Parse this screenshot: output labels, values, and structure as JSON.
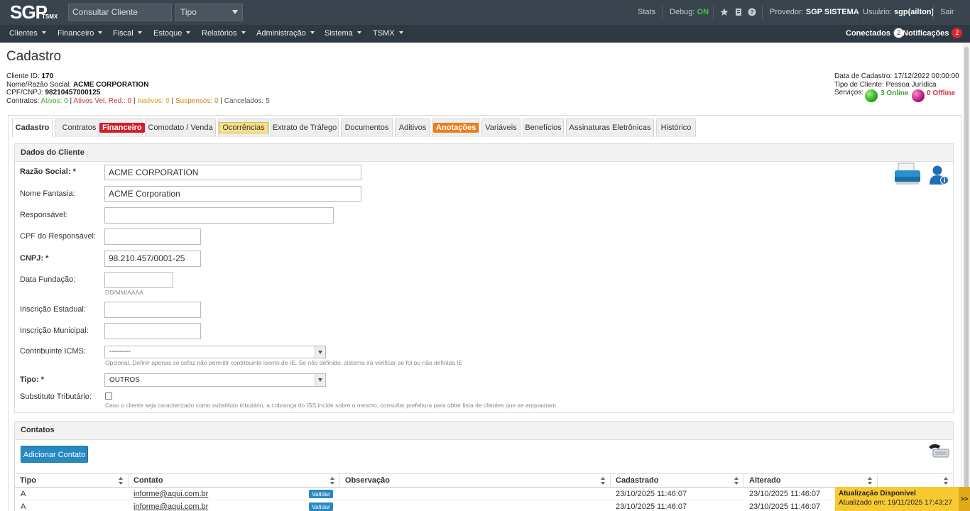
{
  "topbar": {
    "logo_text": "SGP",
    "logo_sub": "TSMX",
    "search_placeholder": "Consultar Cliente",
    "type_select": "Tipo",
    "stats": "Stats",
    "debug_label": "Debug:",
    "debug_value": "ON",
    "provider_label": "Provedor:",
    "provider_value": "SGP SISTEMA",
    "user_label": "Usuário:",
    "user_value": "sgp(ailton)",
    "logout": "Sair"
  },
  "nav": {
    "items": [
      "Clientes",
      "Financeiro",
      "Fiscal",
      "Estoque",
      "Relatórios",
      "Administração",
      "Sistema",
      "TSMX"
    ],
    "connected_label": "Conectados",
    "connected_count": "2",
    "notifications_label": "Notificações",
    "notifications_count": "2"
  },
  "page": {
    "title": "Cadastro",
    "client_id_label": "Cliente ID:",
    "client_id": "170",
    "name_label": "Nome/Razão Social:",
    "name": "ACME CORPORATION",
    "doc_label": "CPF/CNPJ:",
    "doc": "98210457000125",
    "contracts_label": "Contratos:",
    "active": "Ativos: 0",
    "active_red": "Ativos Vel. Red.: 0",
    "inactive": "Inativos: 0",
    "suspended": "Suspensos: 0",
    "cancelled": "Cancelados: 5",
    "reg_date_label": "Data de Cadastro:",
    "reg_date": "17/12/2022 00:00:00",
    "client_type_label": "Tipo de Cliente:",
    "client_type": "Pessoa Jurídica",
    "services_label": "Serviços:",
    "online": "3 Online",
    "offline": "0 Offline"
  },
  "tabs": [
    "Cadastro",
    "Contratos",
    "Financeiro",
    "Comodato / Venda",
    "Ocorrências",
    "Extrato de Tráfego",
    "Documentos",
    "Aditivos",
    "Anotações",
    "Variáveis",
    "Benefícios",
    "Assinaturas Eletrônicas",
    "Histórico"
  ],
  "form": {
    "section_title": "Dados do Cliente",
    "razao_label": "Razão Social:",
    "razao_value": "ACME CORPORATION",
    "fantasia_label": "Nome Fantasia:",
    "fantasia_value": "ACME Corporation",
    "responsavel_label": "Responsável:",
    "responsavel_value": "",
    "cpf_resp_label": "CPF do Responsável:",
    "cpf_resp_value": "",
    "cnpj_label": "CNPJ:",
    "cnpj_value": "98.210.457/0001-25",
    "fundacao_label": "Data Fundação:",
    "fundacao_value": "",
    "fundacao_help": "DD/MM/AAAA",
    "ie_label": "Inscrição Estadual:",
    "ie_value": "",
    "im_label": "Inscrição Municipal:",
    "im_value": "",
    "icms_label": "Contribuinte ICMS:",
    "icms_value": "---------",
    "icms_help": "Opcional. Definir apenas se sefaz não permitir contribuinte isento de IE. Se não definido, sistema irá verificar se foi ou não definida IE",
    "tipo_label": "Tipo:",
    "tipo_value": "OUTROS",
    "subst_label": "Substituto Tributário:",
    "subst_help": "Caso o cliente seja caracterizado como substituto tributário, a cobrança do ISS incide sobre o mesmo, consultar prefeitura para obter lista de clientes que se enquadram",
    "required_mark": "*"
  },
  "contacts": {
    "section_title": "Contatos",
    "add_button": "Adicionar Contato",
    "columns": [
      "Tipo",
      "Contato",
      "Observação",
      "Cadastrado",
      "Alterado",
      ""
    ],
    "rows": [
      {
        "tipo": "A",
        "contato": "informe@aqui.com.br",
        "badge": "Validar",
        "obs": "",
        "cadastrado": "23/10/2025 11:46:07",
        "alterado": "23/10/2025 11:46:07"
      },
      {
        "tipo": "A",
        "contato": "informe@aqui.com.br",
        "badge": "Validar",
        "obs": "",
        "cadastrado": "23/10/2025 11:46:07",
        "alterado": "23/10/2025 11:46:07"
      }
    ]
  },
  "update": {
    "title": "Atualização Disponível",
    "text": "Atualizado em: 19/11/2025 17:43:27",
    "arrow": ">>"
  }
}
